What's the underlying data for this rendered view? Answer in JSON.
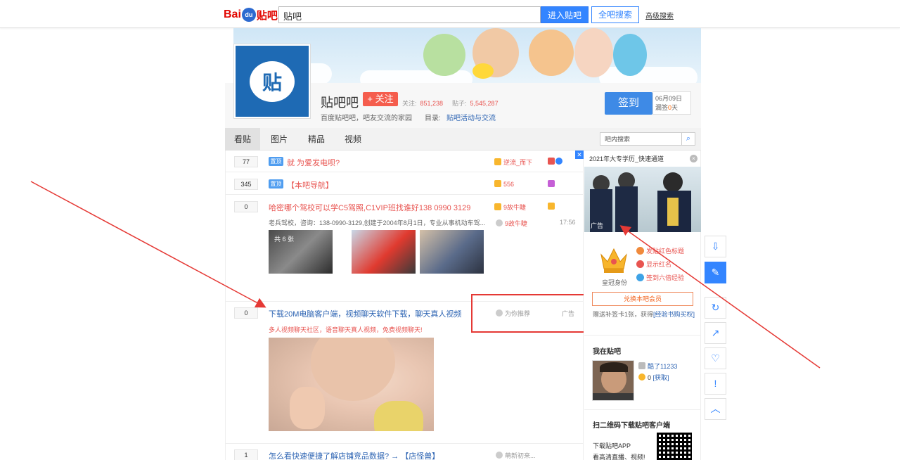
{
  "header": {
    "logo_text_1": "Bai",
    "logo_text_2": "du",
    "logo_text_3": "贴吧",
    "search_value": "贴吧",
    "enter_button": "进入贴吧",
    "search_all_button": "全吧搜索",
    "advanced_link": "高级搜索"
  },
  "forum": {
    "avatar_char": "贴",
    "name": "贴吧吧",
    "follow": "+ 关注",
    "follow_label": "关注:",
    "follow_count": "851,238",
    "posts_label": "贴子:",
    "posts_count": "5,545,287",
    "slogan": "百度贴吧吧，吧友交流的家园",
    "dir_label": "目录:",
    "dir_link": "贴吧活动与交流",
    "sign_button": "签到",
    "sign_date": "06月09日",
    "sign_streak_prefix": "漏签",
    "sign_streak_value": "0",
    "sign_streak_suffix": "天"
  },
  "tabs": {
    "items": [
      "看贴",
      "图片",
      "精品",
      "视频"
    ],
    "search_placeholder": "吧内搜索",
    "search_icon": "search-icon"
  },
  "threads": [
    {
      "replies": "77",
      "tag": "置顶",
      "title": "就 为爱发电呗?",
      "author": "逆流_而下"
    },
    {
      "replies": "345",
      "tag": "置顶",
      "title": "【本吧导航】",
      "author": "556"
    },
    {
      "replies": "0",
      "title": "哈密哪个驾校可以学C5驾照,C1VIP班找谁好138 0990 3129",
      "author": "9故牛睫",
      "desc": "老兵驾校，咨询：138-0990-3129,创建于2004年8月1日，专业从事机动车驾...",
      "last_reply_author": "9故牛睫",
      "time": "17:56",
      "image_count": "共 6 张"
    },
    {
      "replies": "0",
      "title": "下载20M电脑客户端，视频聊天软件下载，聊天真人视频",
      "desc": "多人视频聊天社区，语音聊天真人视频，免费视频聊天!",
      "recommend": "为你推荐",
      "ad": "广告"
    },
    {
      "replies": "1",
      "title": "怎么看快速便捷了解店铺竞品数据? → 【店怪兽】",
      "author": "萌新初来..."
    }
  ],
  "sidebar": {
    "ad_title": "2021年大专学历_快速通道",
    "ad_tag": "广告",
    "crown_label": "皇冠身份",
    "perks": [
      "发贴红色标题",
      "显示红名",
      "签到六倍经验"
    ],
    "vip_button": "兑换本吧会员",
    "gift_text": "赠送补签卡1张，获得",
    "gift_link": "[经验书购买权]",
    "my_forum_title": "我在贴吧",
    "user_stat_1": "酷了11233",
    "user_stat_2_value": "0",
    "user_stat_2_link": "[获取]",
    "qr_title": "扫二维码下载贴吧客户端",
    "qr_text_1": "下载贴吧APP",
    "qr_text_2": "看高清直播、视频!"
  },
  "float_toolbar": [
    {
      "icon": "download-icon",
      "glyph": "⇩"
    },
    {
      "icon": "edit-icon",
      "glyph": "✎"
    },
    {
      "icon": "refresh-icon",
      "glyph": "↻"
    },
    {
      "icon": "share-icon",
      "glyph": "↗"
    },
    {
      "icon": "favorite-icon",
      "glyph": "♡"
    },
    {
      "icon": "report-icon",
      "glyph": "!"
    },
    {
      "icon": "back-to-top-icon",
      "glyph": "︿"
    }
  ],
  "colors": {
    "accent": "#3385ff",
    "title_red": "#e85450",
    "link_blue": "#2d64b3",
    "annotation_red": "#e53935"
  }
}
